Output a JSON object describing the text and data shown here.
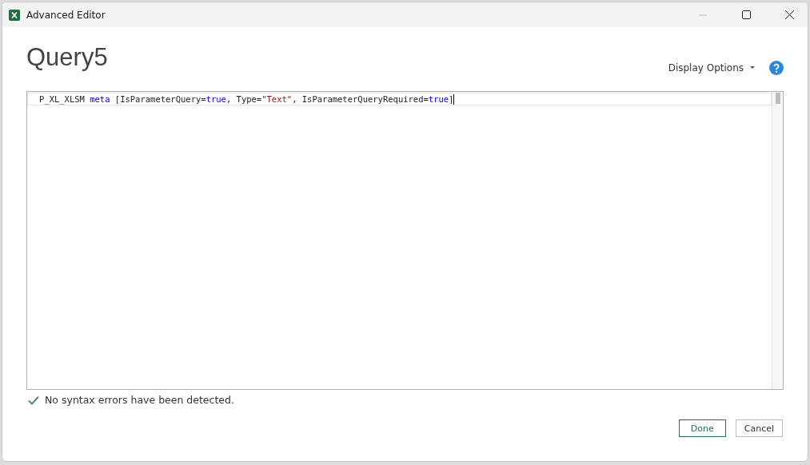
{
  "window": {
    "title": "Advanced Editor"
  },
  "query_name": "Query5",
  "display_options": {
    "label": "Display Options"
  },
  "editor": {
    "lines": [
      {
        "current": true,
        "tokens": [
          {
            "kind": "plain",
            "text": "P_XL_XLSM "
          },
          {
            "kind": "keyword",
            "text": "meta"
          },
          {
            "kind": "plain",
            "text": " [IsParameterQuery="
          },
          {
            "kind": "keyword",
            "text": "true"
          },
          {
            "kind": "plain",
            "text": ", Type="
          },
          {
            "kind": "string",
            "text": "\"Text\""
          },
          {
            "kind": "plain",
            "text": ", IsParameterQueryRequired="
          },
          {
            "kind": "keyword",
            "text": "true"
          },
          {
            "kind": "plain",
            "text": "]"
          }
        ]
      }
    ]
  },
  "status": {
    "ok": true,
    "text": "No syntax errors have been detected."
  },
  "buttons": [
    {
      "label": "Done",
      "primary": true
    },
    {
      "label": "Cancel",
      "primary": false
    }
  ]
}
